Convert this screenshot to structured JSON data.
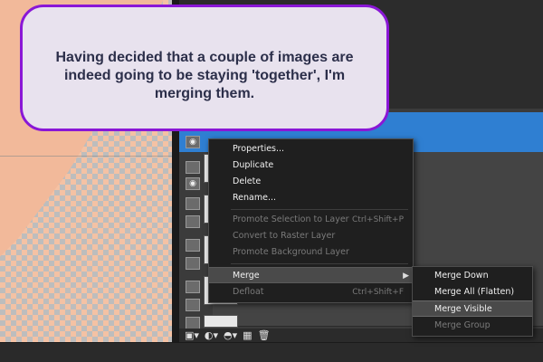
{
  "callout": {
    "text": "Having decided that a couple of images are indeed going to be staying 'together', I'm merging them."
  },
  "context_menu": {
    "items": [
      {
        "label": "Properties...",
        "enabled": true
      },
      {
        "label": "Duplicate",
        "enabled": true
      },
      {
        "label": "Delete",
        "enabled": true
      },
      {
        "label": "Rename...",
        "enabled": true
      },
      {
        "label": "Promote Selection to Layer",
        "shortcut": "Ctrl+Shift+P",
        "enabled": false
      },
      {
        "label": "Convert to Raster Layer",
        "enabled": false
      },
      {
        "label": "Promote Background Layer",
        "enabled": false
      },
      {
        "label": "Merge",
        "enabled": true,
        "highlighted": true
      },
      {
        "label": "Defloat",
        "shortcut": "Ctrl+Shift+F",
        "enabled": false
      }
    ]
  },
  "submenu": {
    "items": [
      {
        "label": "Merge Down",
        "enabled": true
      },
      {
        "label": "Merge All (Flatten)",
        "enabled": true
      },
      {
        "label": "Merge Visible",
        "enabled": true,
        "highlighted": true
      },
      {
        "label": "Merge Group",
        "enabled": false
      }
    ]
  },
  "colors": {
    "accent": "#8a17d6",
    "selected_layer": "#2f7fd2",
    "menu_bg": "#1f1f1f"
  },
  "icons": [
    "eye-icon",
    "layer-icon",
    "new-layer-icon",
    "adjust-icon",
    "mask-icon",
    "group-icon",
    "trash-icon",
    "submenu-arrow-icon"
  ]
}
